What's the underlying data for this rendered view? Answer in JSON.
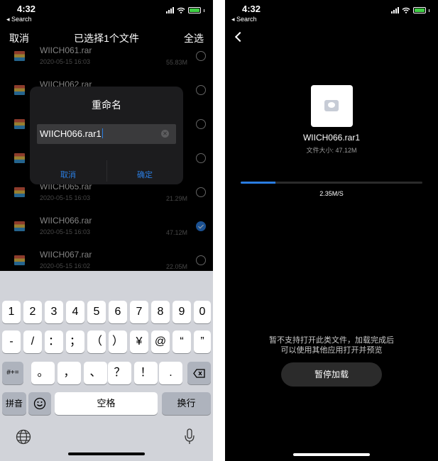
{
  "left": {
    "status": {
      "time": "4:32",
      "back": "◂ Search"
    },
    "header": {
      "cancel": "取消",
      "title": "已选择1个文件",
      "select_all": "全选"
    },
    "files": [
      {
        "name": "WIICH061.rar",
        "date": "2020-05-15 16:03",
        "size": "55.83M",
        "checked": false
      },
      {
        "name": "WIICH062.rar",
        "date": "",
        "size": "",
        "checked": false
      },
      {
        "name": "",
        "date": "",
        "size": "",
        "checked": false
      },
      {
        "name": "",
        "date": "",
        "size": "",
        "checked": false
      },
      {
        "name": "WIICH065.rar",
        "date": "2020-05-15 16:03",
        "size": "21.29M",
        "checked": false
      },
      {
        "name": "WIICH066.rar",
        "date": "2020-05-15 16:03",
        "size": "47.12M",
        "checked": true
      },
      {
        "name": "WIICH067.rar",
        "date": "2020-05-15 16:02",
        "size": "22.05M",
        "checked": false
      }
    ],
    "dialog": {
      "title": "重命名",
      "value": "WIICH066.rar1",
      "cancel": "取消",
      "confirm": "确定"
    },
    "keyboard": {
      "row1": [
        "1",
        "2",
        "3",
        "4",
        "5",
        "6",
        "7",
        "8",
        "9",
        "0"
      ],
      "row2": [
        "-",
        "/",
        "：",
        "；",
        "（",
        "）",
        "¥",
        "@",
        "“",
        "”"
      ],
      "shift_label": "#+=",
      "row3": [
        "。",
        "，",
        "、",
        "？",
        "！",
        "."
      ],
      "pinyin": "拼音",
      "space": "空格",
      "return": "换行"
    }
  },
  "right": {
    "status": {
      "time": "4:32",
      "back": "◂ Search"
    },
    "file_name": "WIICH066.rar1",
    "file_size": "文件大小: 47.12M",
    "progress": 0.19,
    "speed": "2.35M/S",
    "note_line1": "暂不支持打开此类文件，加载完成后",
    "note_line2": "可以使用其他应用打开并预览",
    "pause_label": "暂停加载"
  },
  "colors": {
    "accent": "#2a7de1",
    "background": "#000000",
    "keyboard": "#d1d3d9"
  }
}
